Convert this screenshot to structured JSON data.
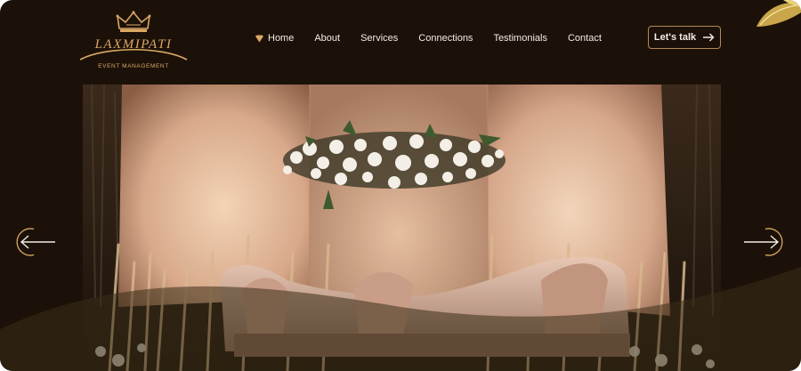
{
  "brand": {
    "name": "LAXMIPATI",
    "tagline": "EVENT MANAGEMENT"
  },
  "nav": {
    "items": [
      {
        "label": "Home",
        "icon": "heart-icon",
        "active": true
      },
      {
        "label": "About"
      },
      {
        "label": "Services"
      },
      {
        "label": "Connections"
      },
      {
        "label": "Testimonials"
      },
      {
        "label": "Contact"
      }
    ],
    "cta_label": "Let's talk",
    "cta_icon": "arrow-right-icon"
  },
  "hero": {
    "image_subject": "Decorated stage with floral arrangement and sofa",
    "prev_icon": "arrow-left-icon",
    "next_icon": "arrow-right-icon"
  },
  "colors": {
    "background": "#1c1108",
    "accent_gold": "#d9a865",
    "nav_text": "#f3ece2",
    "button_border": "#b48a55"
  }
}
